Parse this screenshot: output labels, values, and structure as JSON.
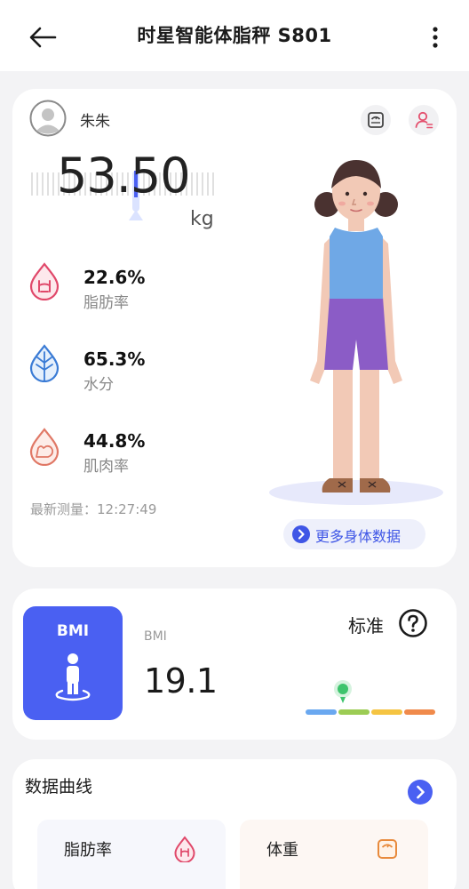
{
  "header": {
    "title": "时星智能体脂秤 S801"
  },
  "user": {
    "name": "朱朱"
  },
  "weight": {
    "value": "53.50",
    "unit": "kg"
  },
  "metrics": [
    {
      "value": "22.6%",
      "label": "脂肪率",
      "icon": "body-fat-drop-icon",
      "color": "#e0486a"
    },
    {
      "value": "65.3%",
      "label": "水分",
      "icon": "water-leaf-icon",
      "color": "#3a7bd5"
    },
    {
      "value": "44.8%",
      "label": "肌肉率",
      "icon": "muscle-arm-icon",
      "color": "#e07866"
    }
  ],
  "measure_time": "最新测量：12:27:49",
  "more_data_label": "更多身体数据",
  "bmi": {
    "tile_label": "BMI",
    "label": "BMI",
    "value": "19.1",
    "status": "标准",
    "scale_colors": [
      "#6aa8f0",
      "#9ccc54",
      "#f5c442",
      "#f08a4b"
    ]
  },
  "curve": {
    "title": "数据曲线",
    "tiles": [
      {
        "label": "脂肪率",
        "icon": "body-fat-drop-icon"
      },
      {
        "label": "体重",
        "icon": "scale-icon"
      }
    ]
  },
  "colors": {
    "accent": "#4a60f2",
    "marker": "#3ec46d"
  }
}
